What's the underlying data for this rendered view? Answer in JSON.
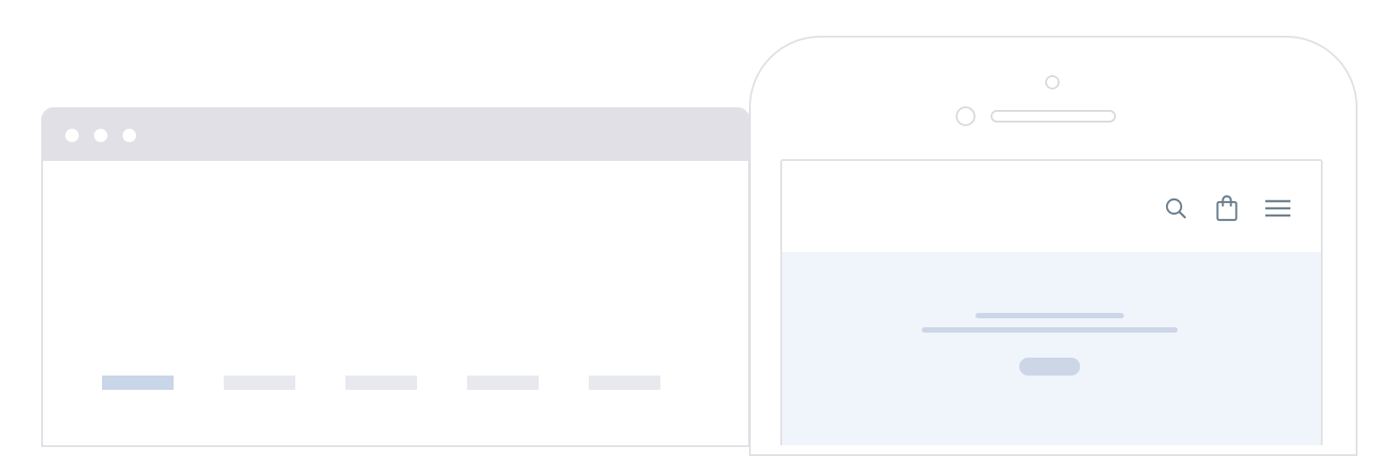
{
  "colors": {
    "frame_border": "#e0e0e6",
    "titlebar": "#e0e0e6",
    "placeholder": "#e8e9ee",
    "placeholder_active": "#c9d6e8",
    "hero_background": "#f0f5fc",
    "hero_placeholder": "#ccd6e6",
    "icon": "#6b7f8e"
  },
  "browser": {
    "window_controls": [
      "dot",
      "dot",
      "dot"
    ],
    "nav_placeholders": [
      {
        "state": "active"
      },
      {
        "state": "inactive"
      },
      {
        "state": "inactive"
      },
      {
        "state": "inactive"
      },
      {
        "state": "inactive"
      }
    ]
  },
  "phone": {
    "header_icons": [
      "search-icon",
      "shopping-bag-icon",
      "hamburger-menu-icon"
    ]
  }
}
